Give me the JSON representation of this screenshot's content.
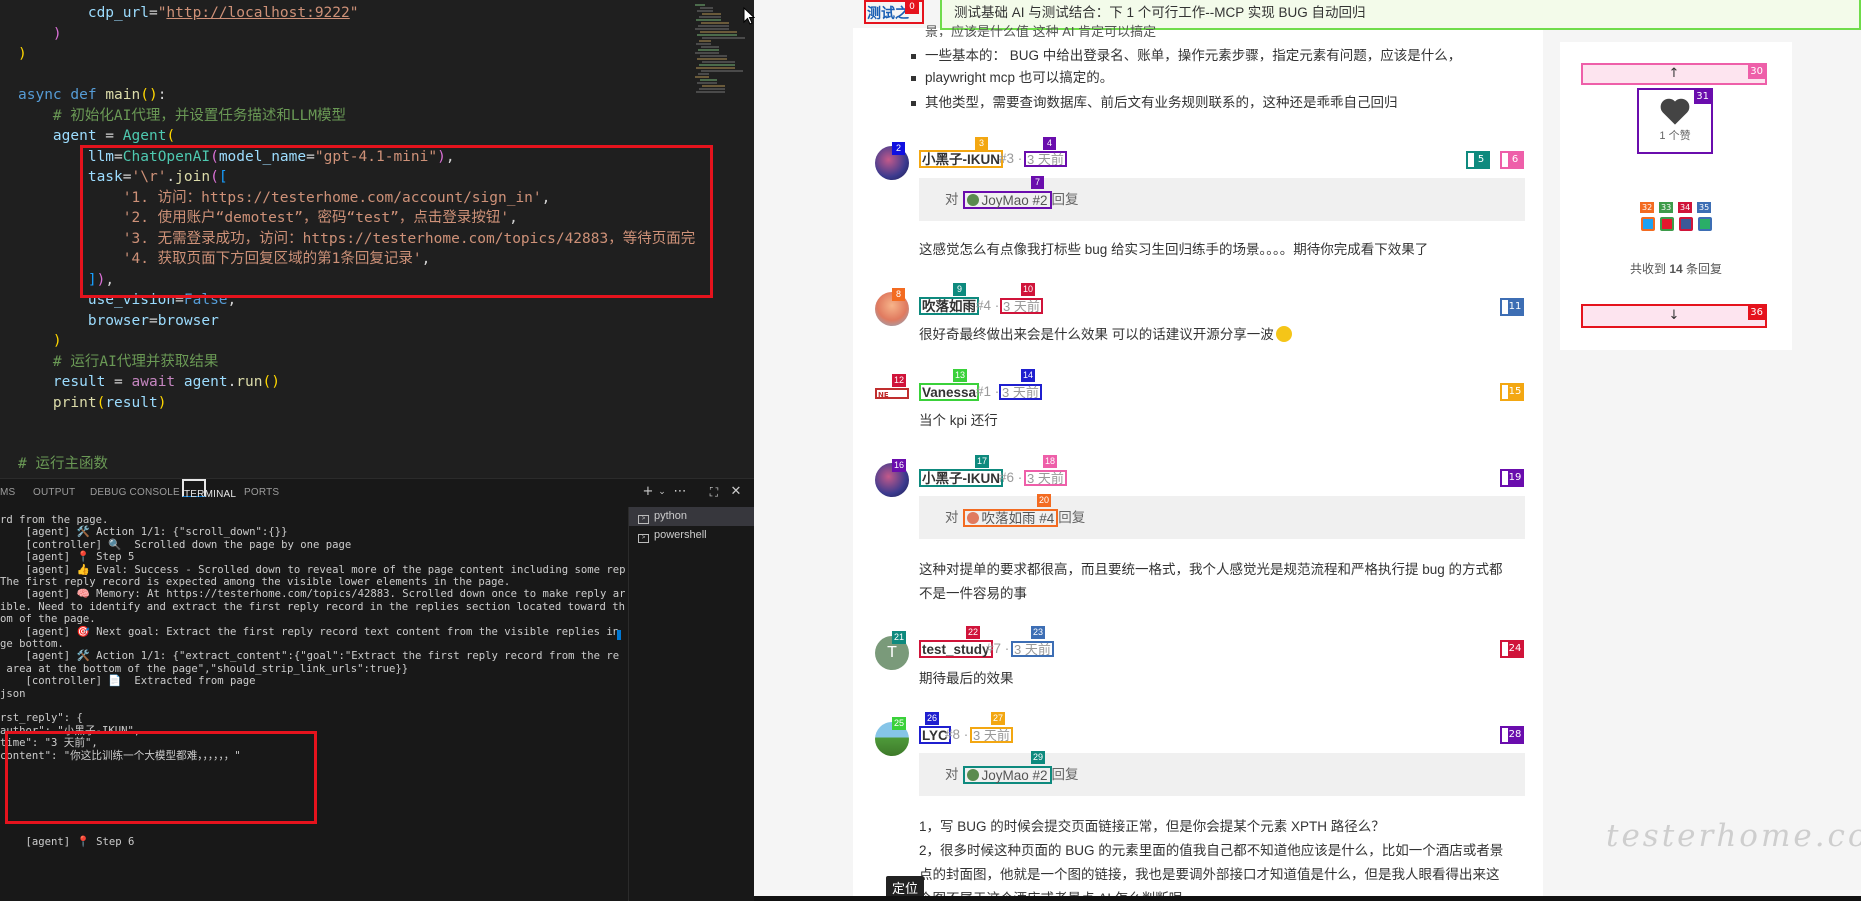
{
  "editor": {
    "lines": [
      [
        "        ",
        [
          "pa",
          "cdp_url"
        ],
        "=",
        [
          "s",
          "\""
        ],
        [
          "u",
          "http://localhost:9222"
        ],
        [
          "s",
          "\""
        ]
      ],
      [
        "    ",
        [
          "br",
          ")"
        ]
      ],
      [
        [
          "by",
          ")"
        ]
      ],
      [
        ""
      ],
      [
        [
          "k",
          "async"
        ],
        " ",
        [
          "k",
          "def"
        ],
        " ",
        [
          "fn",
          "main"
        ],
        [
          "by",
          "("
        ],
        [
          "by",
          ")"
        ],
        ":"
      ],
      [
        "    ",
        [
          "cm",
          "# 初始化AI代理，并设置任务描述和LLM模型"
        ]
      ],
      [
        "    ",
        [
          "pa",
          "agent"
        ],
        " = ",
        [
          "cls",
          "Agent"
        ],
        [
          "by",
          "("
        ]
      ],
      [
        "        ",
        [
          "pa",
          "llm"
        ],
        "=",
        [
          "cls",
          "ChatOpenAI"
        ],
        [
          "br",
          "("
        ],
        [
          "pa",
          "model_name"
        ],
        "=",
        [
          "s",
          "\"gpt-4.1-mini\""
        ],
        [
          "br",
          ")"
        ],
        ","
      ],
      [
        "        ",
        [
          "pa",
          "task"
        ],
        "=",
        [
          "s",
          "'\\r'"
        ],
        ".",
        [
          "fn",
          "join"
        ],
        [
          "br",
          "("
        ],
        [
          "bb",
          "["
        ]
      ],
      [
        "            ",
        [
          "s",
          "'1. 访问：https://testerhome.com/account/sign_in'"
        ],
        ","
      ],
      [
        "            ",
        [
          "s",
          "'2. 使用账户“demotest”，密码“test”，点击登录按钮'"
        ],
        ","
      ],
      [
        "            ",
        [
          "s",
          "'3. 无需登录成功，访问：https://testerhome.com/topics/42883，等待页面完"
        ]
      ],
      [
        "            ",
        [
          "s",
          "'4. 获取页面下方回复区域的第1条回复记录'"
        ],
        ","
      ],
      [
        "        ",
        [
          "bb",
          "]"
        ],
        [
          "br",
          ")"
        ],
        ","
      ],
      [
        "        ",
        [
          "pa",
          "use_vision"
        ],
        "=",
        [
          "k",
          "False"
        ],
        ","
      ],
      [
        "        ",
        [
          "pa",
          "browser"
        ],
        "=",
        [
          "pa",
          "browser"
        ]
      ],
      [
        "    ",
        [
          "by",
          ")"
        ]
      ],
      [
        "    ",
        [
          "cm",
          "# 运行AI代理并获取结果"
        ]
      ],
      [
        "    ",
        [
          "pa",
          "result"
        ],
        " = ",
        [
          "kw",
          "await"
        ],
        " ",
        [
          "pa",
          "agent"
        ],
        ".",
        [
          "fn",
          "run"
        ],
        [
          "by",
          "("
        ],
        [
          "by",
          ")"
        ]
      ],
      [
        "    ",
        [
          "fn",
          "print"
        ],
        [
          "by",
          "("
        ],
        [
          "pa",
          "result"
        ],
        [
          "by",
          ")"
        ]
      ],
      [
        ""
      ],
      [
        ""
      ],
      [
        [
          "cm",
          "# 运行主函数"
        ]
      ]
    ]
  },
  "panel": {
    "tabs": [
      "MS",
      "OUTPUT",
      "DEBUG CONSOLE",
      "TERMINAL",
      "PORTS"
    ],
    "active_tab": "TERMINAL",
    "toolbar_icons": [
      "add-terminal-icon",
      "chevron-down-icon",
      "more-icon",
      "maximize-panel-icon",
      "close-icon"
    ],
    "terminals": [
      "python",
      "powershell"
    ],
    "terminal_lines": [
      "rd from the page.",
      "    [agent] 🛠️ Action 1/1: {\"scroll_down\":{}}",
      "    [controller] 🔍  Scrolled down the page by one page",
      "    [agent] 📍 Step 5",
      "    [agent] 👍 Eval: Success - Scrolled down to reveal more of the page content including some repl",
      "The first reply record is expected among the visible lower elements in the page.",
      "    [agent] 🧠 Memory: At https://testerhome.com/topics/42883. Scrolled down once to make reply are",
      "ible. Need to identify and extract the first reply record in the replies section located toward the",
      "om of the page.",
      "    [agent] 🎯 Next goal: Extract the first reply record text content from the visible replies in t",
      "ge bottom.",
      "    [agent] 🛠️ Action 1/1: {\"extract_content\":{\"goal\":\"Extract the first reply record from the re",
      " area at the bottom of the page\",\"should_strip_link_urls\":true}}",
      "    [controller] 📄  Extracted from page",
      "json",
      "",
      "rst_reply\": {",
      "author\": \"小黑子-IKUN\",",
      "time\": \"3 天前\",",
      "content\": \"你这比训练一个大模型都难，，，，，，\"",
      "",
      "",
      "",
      "",
      "",
      "",
      "    [agent] 📍 Step 6"
    ]
  },
  "browser": {
    "site_name": "测试之家",
    "banner": "测试基础  AI 与测试结合：下 1 个可行工作--MCP 实现 BUG 自动回归",
    "intro_line": "景，应该是什么值  这种 AI 肯定可以搞定",
    "bullets": [
      "一些基本的： BUG 中给出登录名、账单，操作元素步骤，指定元素有问题，应该是什么，",
      "playwright mcp 也可以搞定的。",
      "其他类型，需要查询数据库、前后文有业务规则联系的，这种还是乖乖自己回归"
    ],
    "replies": [
      {
        "author": "小黑子-IKUN",
        "floor": "#3 ·",
        "time": "3 天前",
        "quote_prefix": "对",
        "quote_link": "JoyMao #2",
        "quote_suffix": "回复",
        "body": "这感觉怎么有点像我打标些 bug 给实习生回归练手的场景。。。。期待你完成看下效果了"
      },
      {
        "author": "吹落如雨",
        "floor": "#4 ·",
        "time": "3 天前",
        "body": "很好奇最终做出来会是什么效果 可以的话建议开源分享一波"
      },
      {
        "author": "Vanessa",
        "floor": "#1 ·",
        "time": "3 天前",
        "body": "当个 kpi 还行"
      },
      {
        "author": "小黑子-IKUN",
        "floor": "#6 ·",
        "time": "3 天前",
        "quote_prefix": "对",
        "quote_link": "吹落如雨 #4",
        "quote_suffix": "回复",
        "body": "这种对提单的要求都很高，而且要统一格式，我个人感觉光是规范流程和严格执行提 bug 的方式都",
        "body2": "不是一件容易的事"
      },
      {
        "author": "test_study",
        "floor": "#7 ·",
        "time": "3 天前",
        "body": "期待最后的效果"
      },
      {
        "author": "LYC",
        "floor": "#8 ·",
        "time": "3 天前",
        "quote_prefix": "对",
        "quote_link": "JoyMao #2",
        "quote_suffix": "回复",
        "body": "1，写 BUG 的时候会提交页面链接正常，但是你会提某个元素 XPTH 路径么？",
        "body2": "2，很多时候这种页面的 BUG 的元素里面的值我自己都不知道他应该是什么，比如一个酒店或者景",
        "body3": "点的封面图，他就是一个图的链接，我也是要调外部接口才知道值是什么，但是我人眼看得出来这",
        "body4": "个图不属于这个酒店或者景点 AI 怎么判断呢"
      }
    ],
    "avatar_letter": "T",
    "sidebar": {
      "like_count": "1 个赞",
      "reply_summary_prefix": "共收到 ",
      "reply_summary_count": "14",
      "reply_summary_suffix": " 条回复",
      "share_icons": [
        "twitter-icon",
        "weibo-icon",
        "facebook-icon",
        "wechat-icon"
      ]
    },
    "watermark": "testerhome.com",
    "locate_label": "定位",
    "badge_numbers": [
      "0",
      "1",
      "2",
      "3",
      "4",
      "5",
      "6",
      "7",
      "8",
      "9",
      "10",
      "11",
      "12",
      "13",
      "14",
      "15",
      "16",
      "17",
      "18",
      "19",
      "20",
      "21",
      "22",
      "23",
      "24",
      "25",
      "26",
      "27",
      "28",
      "29",
      "30",
      "31",
      "32",
      "33",
      "34",
      "35",
      "36"
    ]
  },
  "colors": {
    "highlight_red": "#e5131d",
    "banner_green": "#6fdc4a",
    "vscode_bg": "#1f1f1f"
  }
}
